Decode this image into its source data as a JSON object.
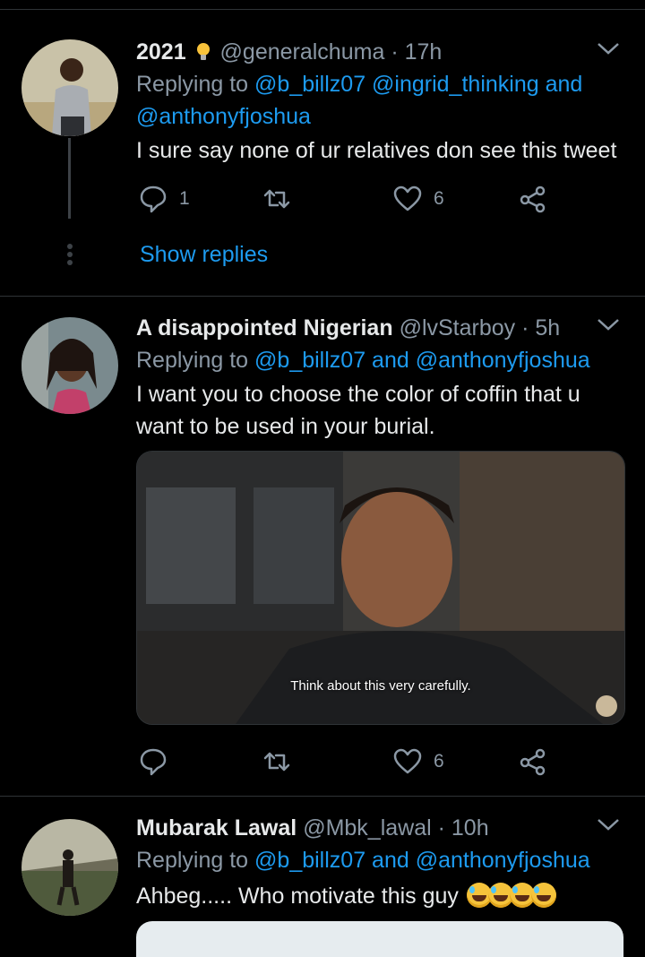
{
  "tweets": [
    {
      "name": "2021",
      "name_emoji": "lightbulb-icon",
      "handle": "@generalchuma",
      "separator": "·",
      "time": "17h",
      "replying_prefix": "Replying to",
      "replying_to": "@b_billz07 @ingrid_thinking and",
      "replying_to_2": "@anthonyfjoshua",
      "text": "I sure say none of ur relatives don see this tweet",
      "reply_count": "1",
      "like_count": "6",
      "show_replies": "Show replies"
    },
    {
      "name": "A disappointed Nigerian",
      "handle": "@lvStarboy",
      "separator": "·",
      "time": "5h",
      "replying_prefix": "Replying to",
      "replying_to": "@b_billz07 and @anthonyfjoshua",
      "text_line1": "I want you to choose the color of coffin that u",
      "text_line2": "want to be used in your burial.",
      "media_caption": "Think about this very carefully.",
      "like_count": "6"
    },
    {
      "name": "Mubarak Lawal",
      "handle": "@Mbk_lawal",
      "separator": "·",
      "time": "10h",
      "replying_prefix": "Replying to",
      "replying_to": "@b_billz07 and @anthonyfjoshua",
      "text": "Ahbeg..... Who motivate this guy",
      "emoji": "rolling-on-floor-laughing x4"
    }
  ],
  "colors": {
    "background": "#000000",
    "link": "#1d9bf0",
    "muted": "#8b98a5",
    "divider": "#2f3336"
  }
}
